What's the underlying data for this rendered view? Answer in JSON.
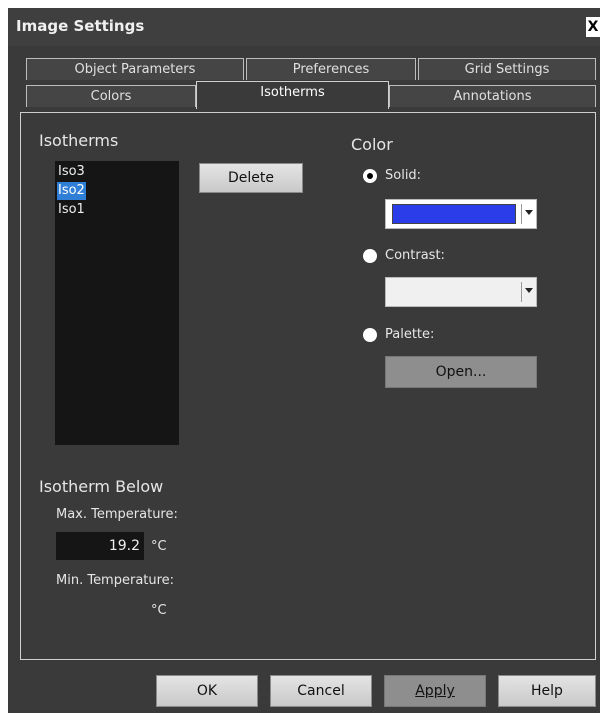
{
  "window": {
    "title": "Image Settings",
    "close_label": "X"
  },
  "tabs_row1": [
    "Object Parameters",
    "Preferences",
    "Grid Settings"
  ],
  "tabs_row2": [
    "Colors",
    "Isotherms",
    "Annotations"
  ],
  "isotherms": {
    "heading": "Isotherms",
    "items": [
      "Iso3",
      "Iso2",
      "Iso1"
    ],
    "selected": "Iso2",
    "delete_label": "Delete"
  },
  "color": {
    "heading": "Color",
    "solid_label": "Solid:",
    "solid_color": "#2b3de8",
    "contrast_label": "Contrast:",
    "palette_label": "Palette:",
    "open_label": "Open...",
    "selected_option": "Solid"
  },
  "isotherm_below": {
    "heading": "Isotherm Below",
    "max_label": "Max. Temperature:",
    "max_value": "19.2",
    "max_unit": "°C",
    "min_label": "Min. Temperature:",
    "min_value": "",
    "min_unit": "°C"
  },
  "buttons": {
    "ok": "OK",
    "cancel": "Cancel",
    "apply": "Apply",
    "help": "Help"
  }
}
